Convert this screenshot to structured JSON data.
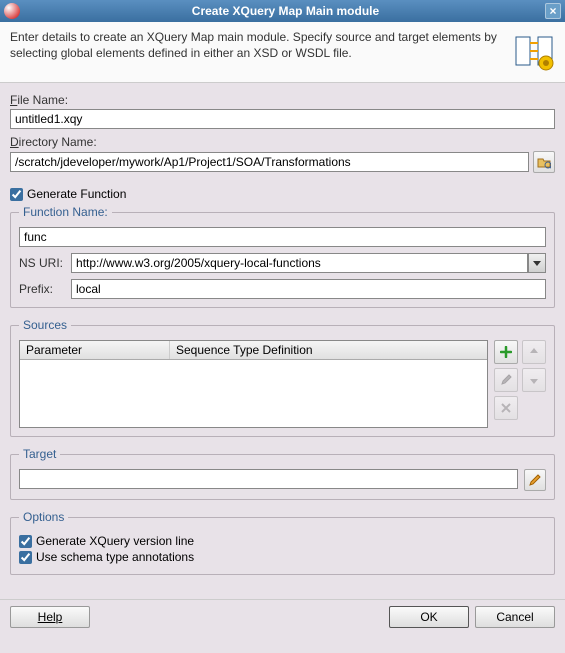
{
  "titlebar": {
    "title": "Create XQuery Map Main module",
    "close": "×"
  },
  "header": {
    "text": "Enter details to create an XQuery Map main module. Specify source and target elements by selecting global elements defined in either an XSD or WSDL file."
  },
  "filename": {
    "label": "File Name:",
    "mnemonic": "F",
    "value": "untitled1.xqy"
  },
  "dirname": {
    "label": "Directory Name:",
    "mnemonic": "D",
    "value": "/scratch/jdeveloper/mywork/Ap1/Project1/SOA/Transformations"
  },
  "generate_fn": {
    "label": "Generate Function",
    "checked": true
  },
  "function": {
    "legend": "Function Name:",
    "name_value": "func",
    "ns_label": "NS URI:",
    "ns_value": "http://www.w3.org/2005/xquery-local-functions",
    "prefix_label": "Prefix:",
    "prefix_value": "local"
  },
  "sources": {
    "legend": "Sources",
    "col1": "Parameter",
    "col2": "Sequence Type Definition"
  },
  "target": {
    "legend": "Target",
    "value": ""
  },
  "options": {
    "legend": "Options",
    "opt1": "Generate XQuery version line",
    "opt1_checked": true,
    "opt2": "Use schema type annotations",
    "opt2_checked": true
  },
  "footer": {
    "help": "Help",
    "ok": "OK",
    "cancel": "Cancel"
  }
}
